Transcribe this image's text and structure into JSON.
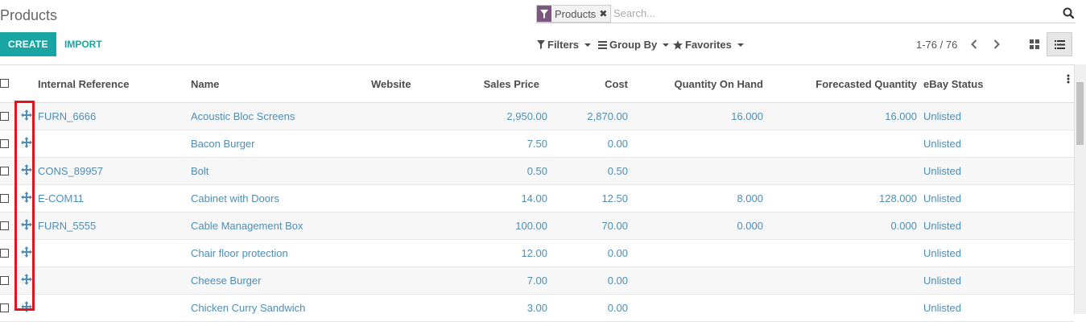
{
  "page": {
    "title": "Products"
  },
  "search": {
    "facet_label": "Products",
    "facet_icon": "filter-icon",
    "placeholder": "Search...",
    "search_icon": "magnifier-icon"
  },
  "toolbar": {
    "create_label": "CREATE",
    "import_label": "IMPORT",
    "filters_label": "Filters",
    "groupby_label": "Group By",
    "favorites_label": "Favorites"
  },
  "pager": {
    "range": "1-76 / 76"
  },
  "colors": {
    "accent": "#1aa5a5",
    "link": "#4f8db4",
    "facet": "#7c5780",
    "highlight": "#e0151e"
  },
  "table": {
    "headers": {
      "internal_reference": "Internal Reference",
      "name": "Name",
      "website": "Website",
      "sales_price": "Sales Price",
      "cost": "Cost",
      "qty_on_hand": "Quantity On Hand",
      "forecasted_qty": "Forecasted Quantity",
      "ebay_status": "eBay Status"
    },
    "rows": [
      {
        "ref": "FURN_6666",
        "name": "Acoustic Bloc Screens",
        "website": "",
        "price": "2,950.00",
        "cost": "2,870.00",
        "qty": "16.000",
        "forecast": "16.000",
        "ebay": "Unlisted"
      },
      {
        "ref": "",
        "name": "Bacon Burger",
        "website": "",
        "price": "7.50",
        "cost": "0.00",
        "qty": "",
        "forecast": "",
        "ebay": "Unlisted"
      },
      {
        "ref": "CONS_89957",
        "name": "Bolt",
        "website": "",
        "price": "0.50",
        "cost": "0.50",
        "qty": "",
        "forecast": "",
        "ebay": "Unlisted"
      },
      {
        "ref": "E-COM11",
        "name": "Cabinet with Doors",
        "website": "",
        "price": "14.00",
        "cost": "12.50",
        "qty": "8.000",
        "forecast": "128.000",
        "ebay": "Unlisted"
      },
      {
        "ref": "FURN_5555",
        "name": "Cable Management Box",
        "website": "",
        "price": "100.00",
        "cost": "70.00",
        "qty": "0.000",
        "forecast": "0.000",
        "ebay": "Unlisted"
      },
      {
        "ref": "",
        "name": "Chair floor protection",
        "website": "",
        "price": "12.00",
        "cost": "0.00",
        "qty": "",
        "forecast": "",
        "ebay": "Unlisted"
      },
      {
        "ref": "",
        "name": "Cheese Burger",
        "website": "",
        "price": "7.00",
        "cost": "0.00",
        "qty": "",
        "forecast": "",
        "ebay": "Unlisted"
      },
      {
        "ref": "",
        "name": "Chicken Curry Sandwich",
        "website": "",
        "price": "3.00",
        "cost": "0.00",
        "qty": "",
        "forecast": "",
        "ebay": "Unlisted"
      }
    ]
  }
}
